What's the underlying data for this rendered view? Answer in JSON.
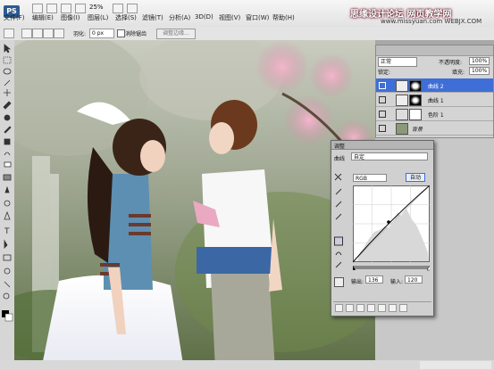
{
  "app": {
    "logo": "PS",
    "zoom": "25%"
  },
  "menu": [
    "文件(F)",
    "编辑(E)",
    "图像(I)",
    "图层(L)",
    "选择(S)",
    "滤镜(T)",
    "分析(A)",
    "3D(D)",
    "视图(V)",
    "窗口(W)",
    "帮助(H)"
  ],
  "watermark": {
    "text": "思缘设计论坛  网页教学网",
    "url": "www.missyuan.com  WEBJX.COM"
  },
  "options": {
    "feather_label": "羽化:",
    "feather_value": "0 px",
    "antialias_label": "消除锯齿",
    "refine_label": "调整边缘..."
  },
  "layers": {
    "blend_mode": "正常",
    "opacity_label": "不透明度:",
    "opacity_value": "100%",
    "lock_label": "锁定:",
    "fill_label": "填充:",
    "fill_value": "100%",
    "items": [
      {
        "name": "曲线 2"
      },
      {
        "name": "曲线 1"
      },
      {
        "name": "色阶 1"
      },
      {
        "name": "背景"
      }
    ]
  },
  "curves": {
    "panel_title": "调整",
    "type_label": "曲线",
    "preset_label": "自定",
    "channel": "RGB",
    "auto_label": "自动",
    "output_label": "输出:",
    "output_value": "136",
    "input_label": "输入:",
    "input_value": "120"
  },
  "colors": {
    "accent": "#3f6fd6",
    "panel_bg": "#d0d0d0"
  }
}
